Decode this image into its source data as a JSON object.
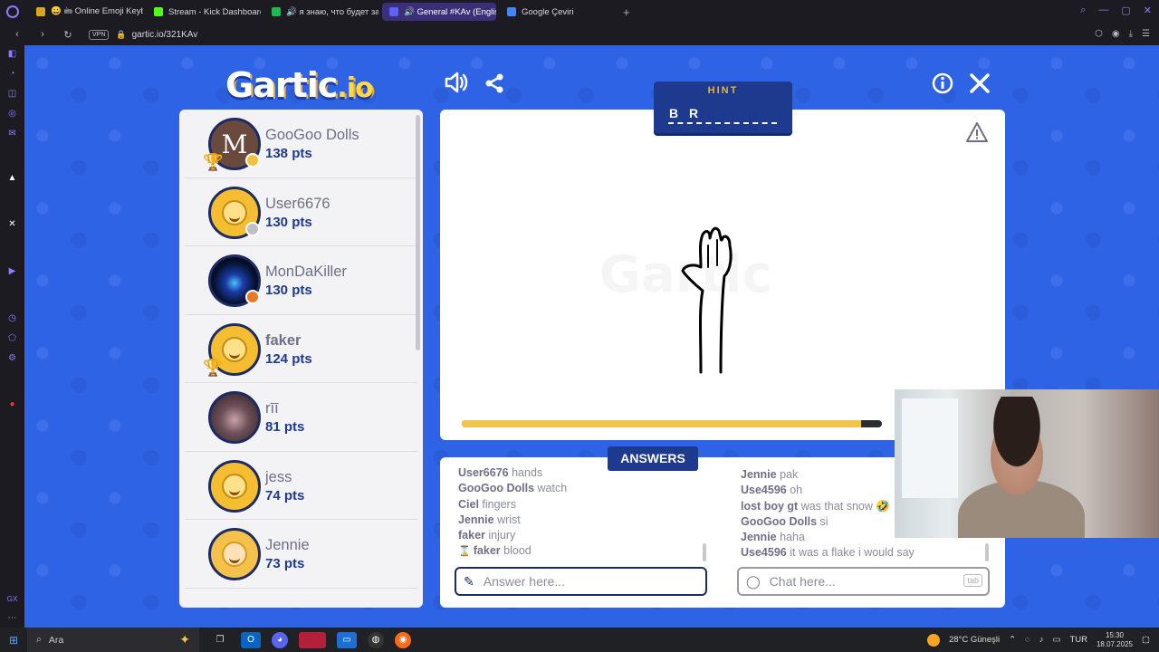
{
  "browser": {
    "tabs": [
      {
        "label": "😀 🖮 Online Emoji Keybo",
        "color": "#d9a520",
        "active": false
      },
      {
        "label": "Stream - Kick Dashboard",
        "color": "#53fc18",
        "active": false
      },
      {
        "label": "🔊 я знаю, что будет за",
        "color": "#1db954",
        "active": false
      },
      {
        "label": "🔊 General #KAv (English",
        "color": "#5865f2",
        "active": true
      },
      {
        "label": "Google Çeviri",
        "color": "#4285f4",
        "active": false
      }
    ],
    "new_tab": "+",
    "vpn": "VPN",
    "url": "gartic.io/321KAv"
  },
  "game": {
    "logo_main": "Gartic",
    "logo_suffix": ".io",
    "hint_title": "HINT",
    "hint_word": "B R",
    "progress": 0.95,
    "answers_title": "ANSWERS",
    "answer_placeholder": "Answer here...",
    "chat_placeholder": "Chat here...",
    "tab_key": "tab",
    "players": [
      {
        "name": "GooGoo Dolls",
        "pts": "138 pts",
        "avatar": "letter",
        "letter": "M",
        "dot": "#f2c23d",
        "trophy": true,
        "bold": false
      },
      {
        "name": "User6676",
        "pts": "130 pts",
        "avatar": "smile",
        "dot": "#bfbfc4",
        "trophy": false,
        "bold": false
      },
      {
        "name": "MonDaKiller",
        "pts": "130 pts",
        "avatar": "galaxy",
        "dot": "#e8782a",
        "trophy": false,
        "bold": false
      },
      {
        "name": "faker",
        "pts": "124 pts",
        "avatar": "smile",
        "dot": null,
        "trophy": true,
        "bold": true
      },
      {
        "name": "rīī",
        "pts": "81 pts",
        "avatar": "photo",
        "dot": null,
        "trophy": false,
        "bold": false
      },
      {
        "name": "jess",
        "pts": "74 pts",
        "avatar": "smile",
        "dot": null,
        "trophy": false,
        "bold": false
      },
      {
        "name": "Jennie",
        "pts": "73 pts",
        "avatar": "blonde",
        "dot": null,
        "trophy": false,
        "bold": false
      }
    ],
    "answers": [
      {
        "user": "User6676",
        "text": "hands"
      },
      {
        "user": "GooGoo Dolls",
        "text": "watch"
      },
      {
        "user": "Ciel",
        "text": "fingers"
      },
      {
        "user": "Jennie",
        "text": "wrist"
      },
      {
        "user": "faker",
        "text": "injury"
      },
      {
        "user": "faker",
        "text": "blood"
      }
    ],
    "chat": [
      {
        "user": "Jennie",
        "text": "pak"
      },
      {
        "user": "Use4596",
        "text": "oh"
      },
      {
        "user": "lost boy gt",
        "text": "was that snow 🤣"
      },
      {
        "user": "GooGoo Dolls",
        "text": "si"
      },
      {
        "user": "Jennie",
        "text": "haha"
      },
      {
        "user": "Use4596",
        "text": "it was a flake i would say"
      }
    ]
  },
  "taskbar": {
    "search_label": "Ara",
    "weather": "28°C Güneşli",
    "lang": "TUR",
    "time": "15:30",
    "date": "18.07.2025"
  }
}
